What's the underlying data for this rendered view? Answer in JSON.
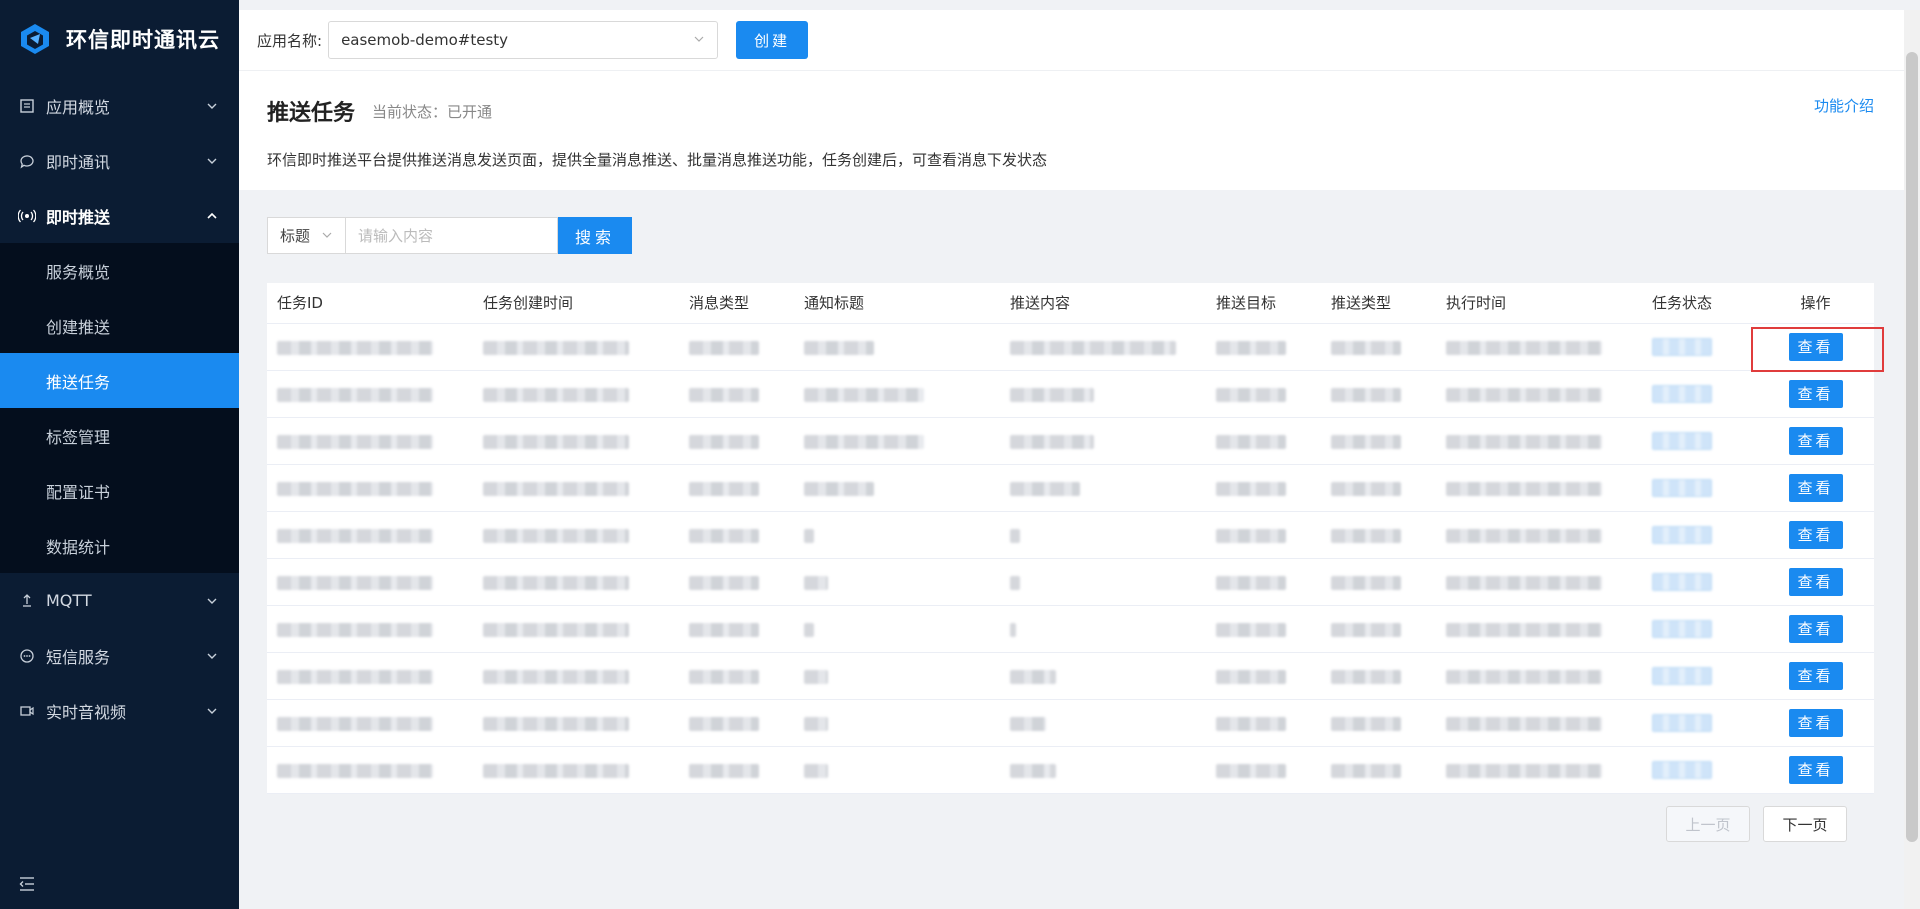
{
  "brand": {
    "title": "环信即时通讯云",
    "accent": "#1a8af0",
    "sidebar_bg": "#0b1c33"
  },
  "sidebar": {
    "items": [
      {
        "label": "应用概览",
        "icon": "app-overview-icon"
      },
      {
        "label": "即时通讯",
        "icon": "chat-icon"
      },
      {
        "label": "即时推送",
        "icon": "push-icon"
      },
      {
        "label": "MQTT",
        "icon": "mqtt-icon"
      },
      {
        "label": "短信服务",
        "icon": "sms-icon"
      },
      {
        "label": "实时音视频",
        "icon": "video-icon"
      }
    ],
    "submenu": [
      "服务概览",
      "创建推送",
      "推送任务",
      "标签管理",
      "配置证书",
      "数据统计"
    ],
    "active_sub": "推送任务"
  },
  "topbar": {
    "app_label": "应用名称:",
    "app_value": "easemob-demo#testy",
    "create_label": "创建"
  },
  "header": {
    "title": "推送任务",
    "status": "当前状态：已开通",
    "intro_link": "功能介绍",
    "description": "环信即时推送平台提供推送消息发送页面，提供全量消息推送、批量消息推送功能，任务创建后，可查看消息下发状态"
  },
  "search": {
    "field": "标题",
    "placeholder": "请输入内容",
    "button": "搜索"
  },
  "table": {
    "columns": [
      "任务ID",
      "任务创建时间",
      "消息类型",
      "通知标题",
      "推送内容",
      "推送目标",
      "推送类型",
      "执行时间",
      "任务状态",
      "操作"
    ],
    "action_label": "查看",
    "row_count": 10
  },
  "pagination": {
    "prev": "上一页",
    "next": "下一页"
  }
}
